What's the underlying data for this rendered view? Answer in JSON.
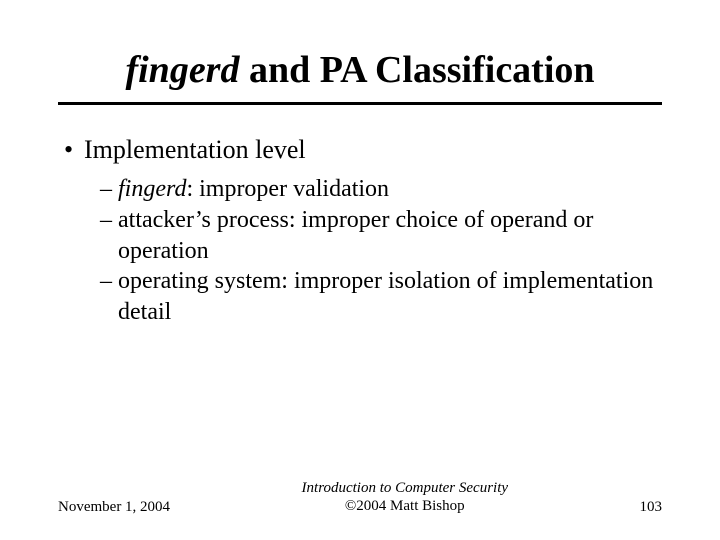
{
  "title": {
    "italic": "fingerd",
    "rest": " and PA Classification"
  },
  "bullet_l1": "Implementation level",
  "sub": [
    {
      "prefix_italic": "fingerd",
      "rest": ": improper validation"
    },
    {
      "plain": "attacker’s process: improper choice of operand or operation"
    },
    {
      "plain": "operating system: improper isolation of implementation detail"
    }
  ],
  "footer": {
    "date": "November 1, 2004",
    "center_line1": "Introduction to Computer Security",
    "center_line2": "©2004 Matt Bishop",
    "page": "103"
  }
}
